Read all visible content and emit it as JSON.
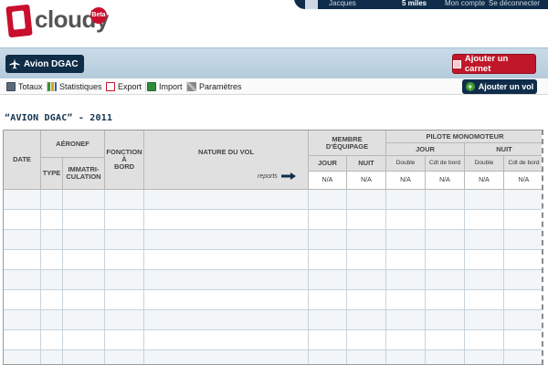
{
  "app": {
    "logo_text": "cloudy",
    "beta_badge": "Beta"
  },
  "topbar": {
    "user_name": "Jacques",
    "miles": "5 miles",
    "account_link": "Mon compte",
    "logout_link": "Se déconnecter"
  },
  "band": {
    "current_carnet": "Avion DGAC",
    "add_carnet_label": "Ajouter un carnet"
  },
  "toolbar": {
    "items": [
      {
        "label": "Totaux",
        "icon": "calculator-icon"
      },
      {
        "label": "Statistiques",
        "icon": "bar-chart-icon"
      },
      {
        "label": "Export",
        "icon": "pdf-icon"
      },
      {
        "label": "Import",
        "icon": "excel-icon"
      },
      {
        "label": "Paramètres",
        "icon": "tools-icon"
      }
    ],
    "add_vol_label": "Ajouter un vol"
  },
  "logbook": {
    "title": "“AVION DGAC” - 2011",
    "headers": {
      "date": "DATE",
      "aeronef": "AÉRONEF",
      "type": "TYPE",
      "immat": "IMMATRI-\nCULATION",
      "fonction": "FONCTION\nÀ\nBORD",
      "nature": "NATURE DU VOL",
      "membre": "MEMBRE\nD'ÉQUIPAGE",
      "membre_jour": "JOUR",
      "membre_nuit": "NUIT",
      "pilote": "PILOTE MONOMOTEUR",
      "pilote_jour": "JOUR",
      "pilote_nuit": "NUIT",
      "double_1": "Double",
      "cdt_1": "Cdt de bord",
      "double_2": "Double",
      "cdt_2": "Cdt de bord"
    },
    "reports_label": "reports",
    "report_values": [
      "N/A",
      "N/A",
      "N/A",
      "N/A",
      "N/A",
      "N/A"
    ],
    "colors": {
      "header_bg": "#e0e0e0",
      "row_alt": "#f2f6f9",
      "navy": "#0f2d4a",
      "red": "#c0182a"
    }
  }
}
